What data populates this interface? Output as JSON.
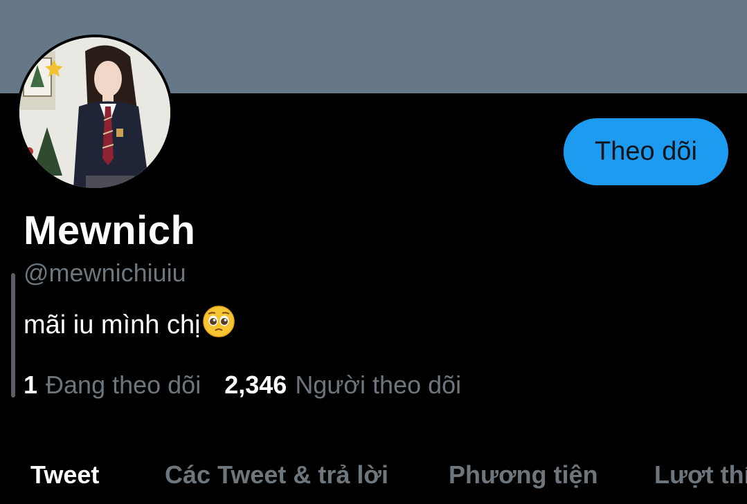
{
  "profile": {
    "display_name": "Mewnich",
    "handle": "@mewnichiuiu",
    "bio": "mãi iu mình chị",
    "bio_emoji": "pleading-face-emoji",
    "avatar_icon": "profile-photo",
    "follow_button_label": "Theo dõi"
  },
  "stats": {
    "following_count": "1",
    "following_label": "Đang theo dõi",
    "followers_count": "2,346",
    "followers_label": "Người theo dõi"
  },
  "tabs": [
    {
      "label": "Tweet",
      "active": true
    },
    {
      "label": "Các Tweet & trả lời",
      "active": false
    },
    {
      "label": "Phương tiện",
      "active": false
    },
    {
      "label": "Lượt thí",
      "active": false
    }
  ],
  "colors": {
    "banner": "#667788",
    "background": "#000000",
    "accent": "#1d9bf0",
    "muted_text": "#6e767d"
  }
}
